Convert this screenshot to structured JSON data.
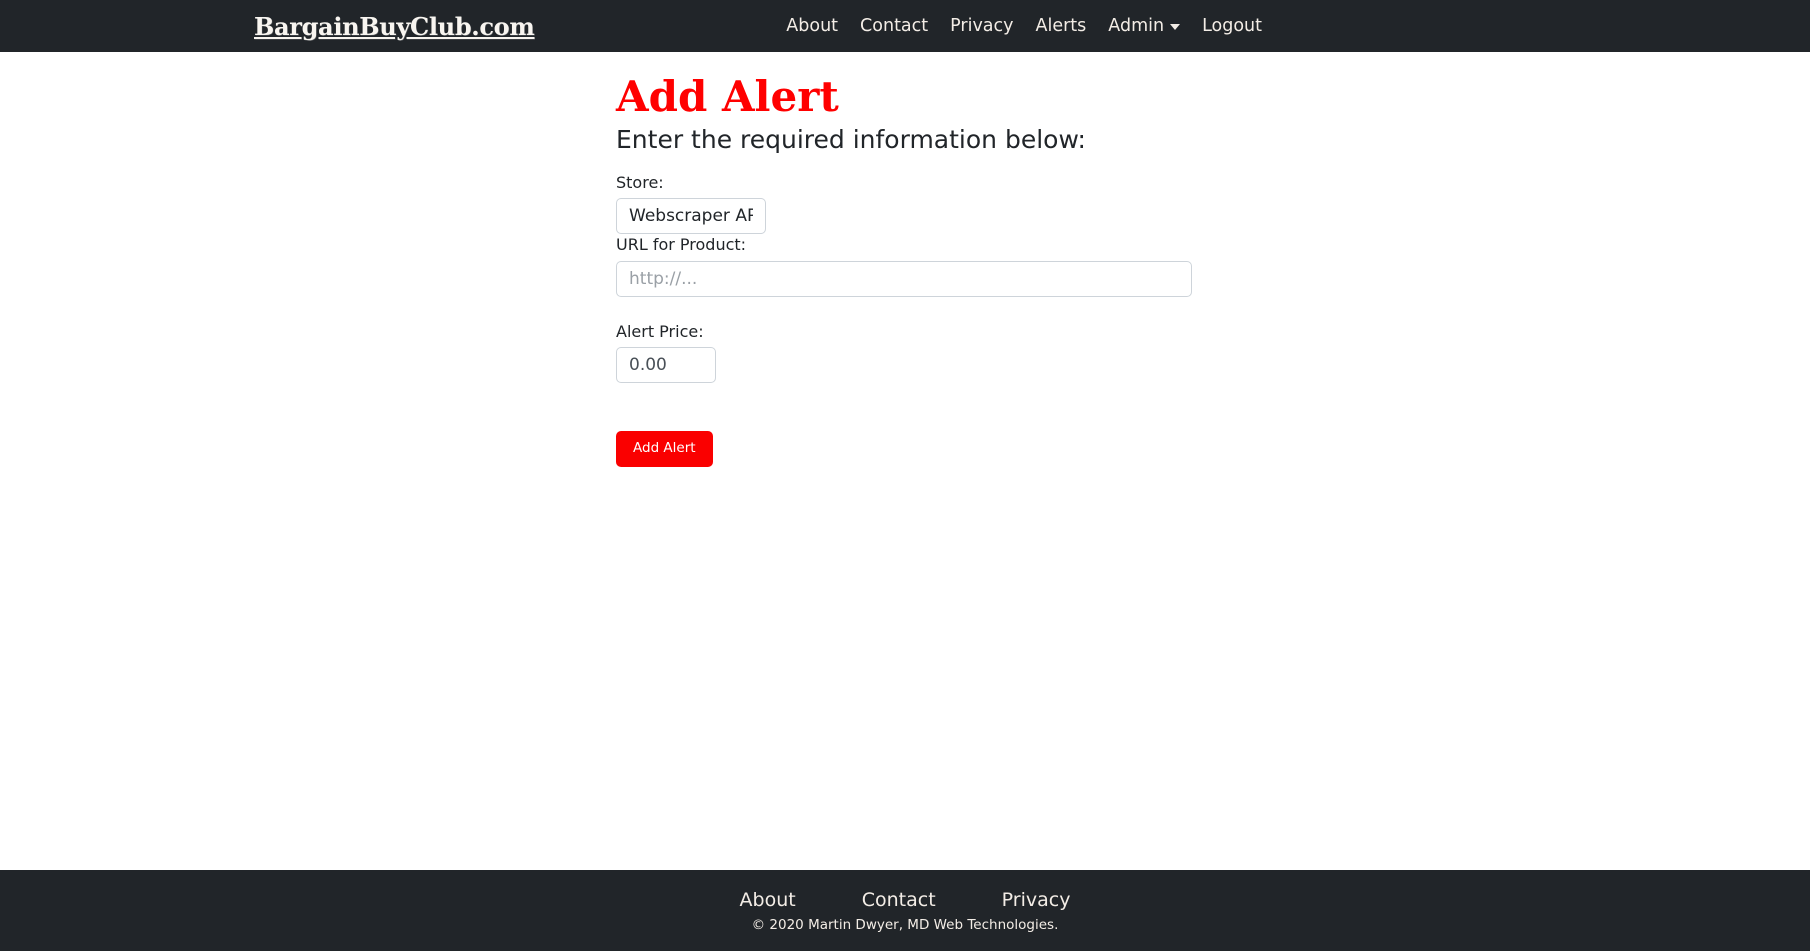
{
  "navbar": {
    "brand": "BargainBuyClub.com",
    "links": [
      {
        "label": "About"
      },
      {
        "label": "Contact"
      },
      {
        "label": "Privacy"
      },
      {
        "label": "Alerts"
      }
    ],
    "dropdown": {
      "label": "Admin",
      "icon": "chevron-down-icon"
    },
    "logout": {
      "label": "Logout"
    },
    "background_color": "#212529",
    "text_color": "#f3ede6"
  },
  "main": {
    "title": "Add Alert",
    "title_color": "#ff0000",
    "subtitle": "Enter the required information below:",
    "form": {
      "store": {
        "label": "Store:",
        "value": "Webscraper API"
      },
      "url": {
        "label": "URL for Product:",
        "value": "",
        "placeholder": "http://..."
      },
      "price": {
        "label": "Alert Price:",
        "value": "0.00",
        "placeholder": "0.00"
      },
      "submit": {
        "label": "Add Alert",
        "color": "#fa0000"
      }
    }
  },
  "footer": {
    "links": [
      {
        "label": "About"
      },
      {
        "label": "Contact"
      },
      {
        "label": "Privacy"
      }
    ],
    "copyright": "© 2020 Martin Dwyer, MD Web Technologies.",
    "background_color": "#212529"
  }
}
